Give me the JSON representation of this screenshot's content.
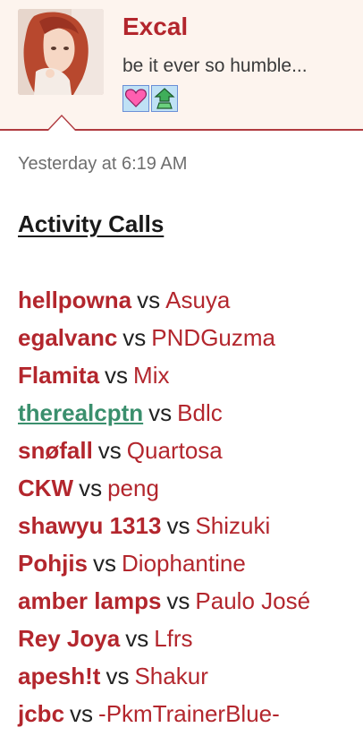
{
  "post": {
    "username": "Excal",
    "user_title": "be it ever so humble...",
    "badges": [
      {
        "name": "heart-badge",
        "color": "#ff5fb0"
      },
      {
        "name": "pokeball-badge",
        "color": "#3fae5a"
      }
    ],
    "timestamp": "Yesterday at 6:19 AM",
    "heading": "Activity Calls",
    "vs_label": "vs",
    "matches": [
      {
        "player_a": "hellpowna",
        "player_b": "Asuya"
      },
      {
        "player_a": "egalvanc",
        "player_b": "PNDGuzma"
      },
      {
        "player_a": "Flamita",
        "player_b": "Mix"
      },
      {
        "player_a": "therealcptn",
        "player_b": "Bdlc"
      },
      {
        "player_a": "snøfall",
        "player_b": "Quartosa"
      },
      {
        "player_a": "CKW",
        "player_b": "peng"
      },
      {
        "player_a": "shawyu 1313",
        "player_b": "Shizuki"
      },
      {
        "player_a": "Pohjis",
        "player_b": "Diophantine"
      },
      {
        "player_a": "amber lamps",
        "player_b": "Paulo José"
      },
      {
        "player_a": "Rey Joya",
        "player_b": "Lfrs"
      },
      {
        "player_a": "apesh!t",
        "player_b": "Shakur"
      },
      {
        "player_a": "jcbc",
        "player_b": "-PkmTrainerBlue-"
      }
    ]
  },
  "colors": {
    "accent": "#b3262d",
    "header_bg": "#fdf4ee",
    "link_alt": "#3a8f6d"
  }
}
